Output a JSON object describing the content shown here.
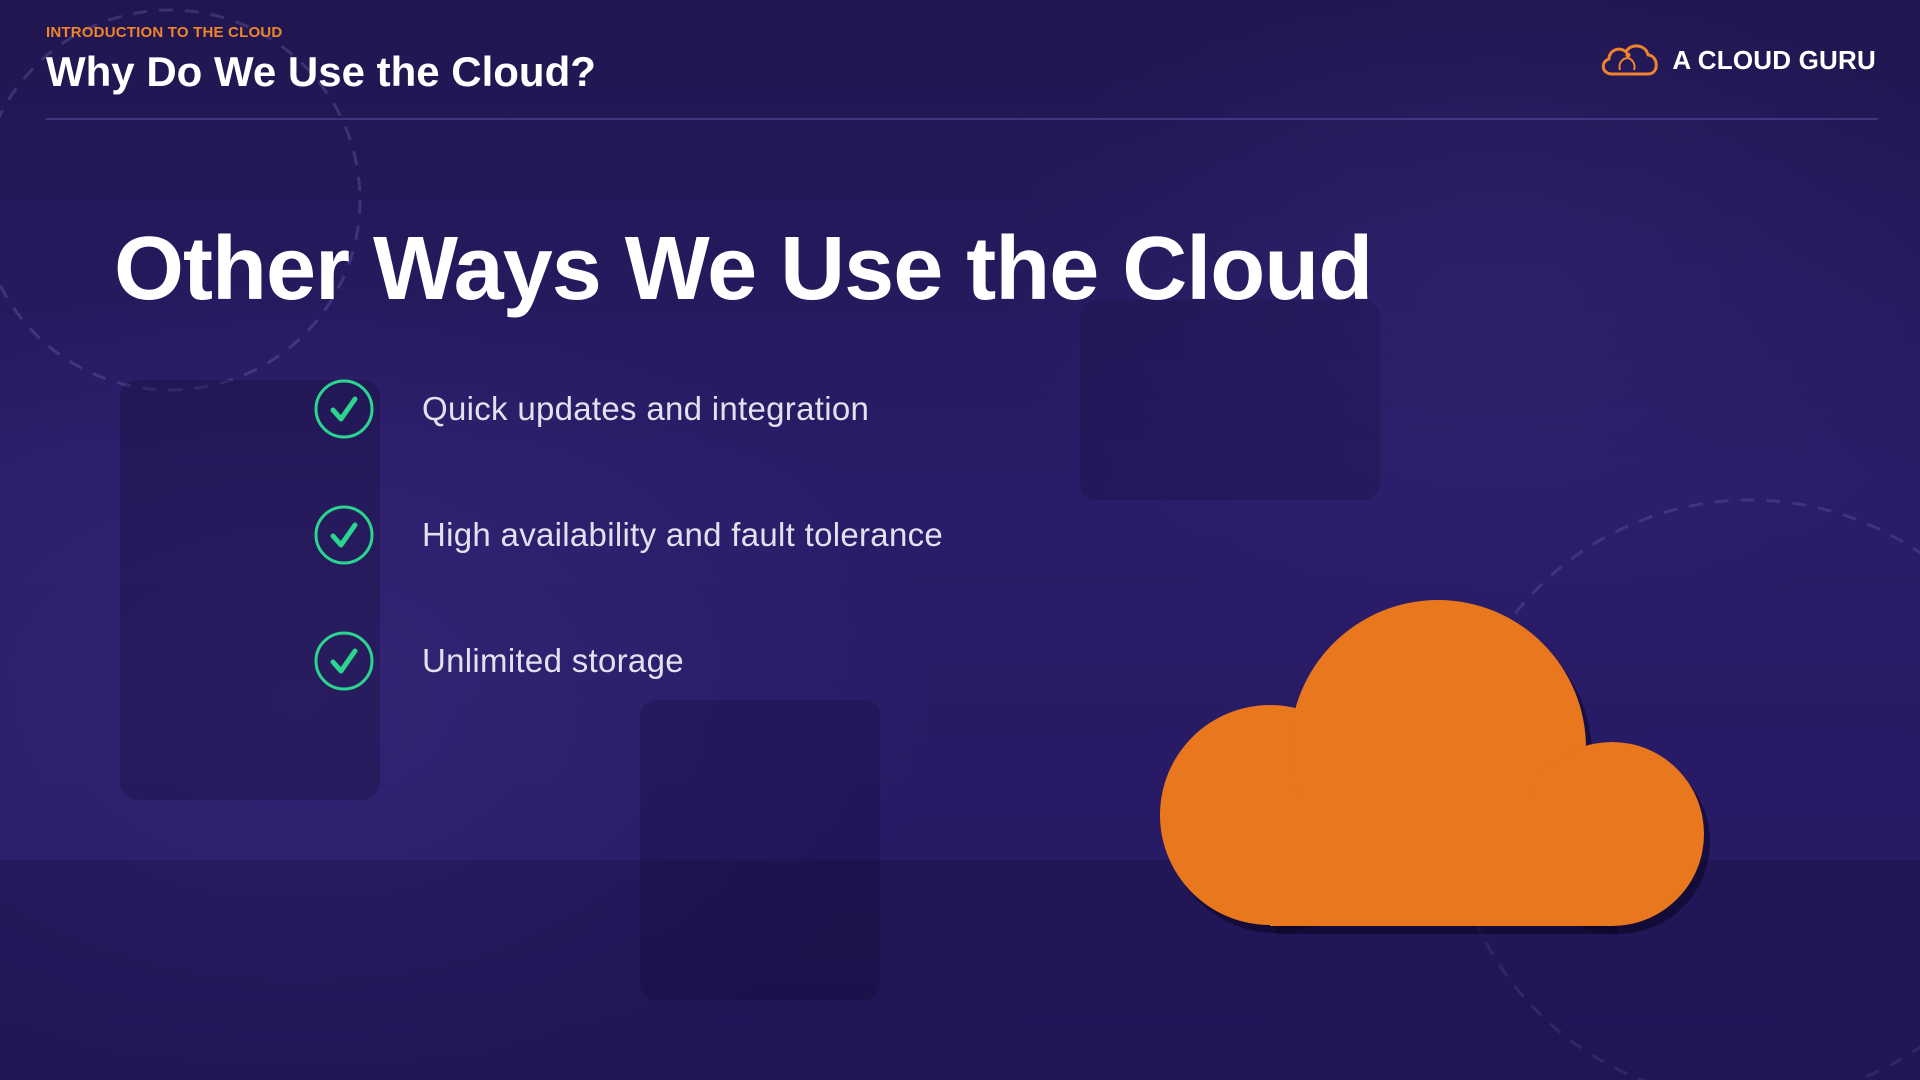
{
  "header": {
    "eyebrow": "INTRODUCTION TO THE CLOUD",
    "title": "Why Do We Use the Cloud?"
  },
  "brand": {
    "name": "A CLOUD GURU",
    "logo_icon": "cloud-guru-logo-icon"
  },
  "main": {
    "heading": "Other Ways We Use the Cloud",
    "bullets": [
      {
        "icon": "check-circle-icon",
        "label": "Quick updates and integration"
      },
      {
        "icon": "check-circle-icon",
        "label": "High availability and fault tolerance"
      },
      {
        "icon": "check-circle-icon",
        "label": "Unlimited storage"
      }
    ],
    "illustration": "cloud-icon"
  },
  "colors": {
    "accent": "#f0842b",
    "background": "#27195f",
    "check": "#2bd48f",
    "cloud": "#e8771e"
  }
}
